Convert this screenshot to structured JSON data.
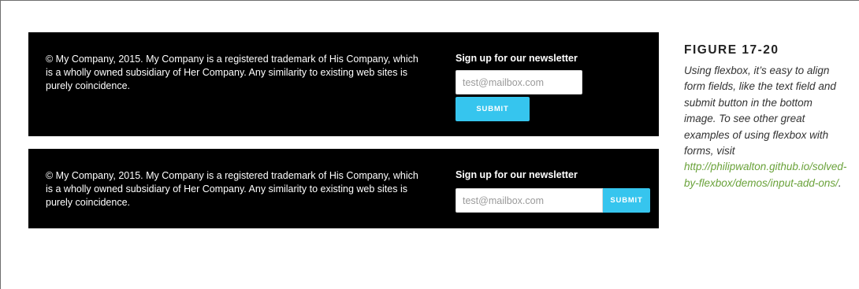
{
  "examples": {
    "top": {
      "copyright": "© My Company, 2015. My Company is a registered trademark of His Company, which is a wholly owned subsidiary of Her Company. Any similarity to existing web sites is purely coincidence.",
      "newsletter_title": "Sign up for our newsletter",
      "email_placeholder": "test@mailbox.com",
      "submit_label": "SUBMIT"
    },
    "bottom": {
      "copyright": "© My Company, 2015. My Company is a registered trademark of His Company, which is a wholly owned subsidiary of Her Company. Any similarity to existing web sites is purely coincidence.",
      "newsletter_title": "Sign up for our newsletter",
      "email_placeholder": "test@mailbox.com",
      "submit_label": "SUBMIT"
    }
  },
  "caption": {
    "figure_label": "FIGURE 17-20",
    "text": "Using flexbox, it’s easy to align form fields, like the text field and submit button in the bottom image. To see other great examples of using flexbox with forms, visit ",
    "link_text": "http://philipwalton.github.io/solved-by-flexbox/demos/input-add-ons/",
    "text_end": "."
  },
  "colors": {
    "footer_background": "#000000",
    "submit_button": "#36c5ee",
    "link": "#6aa23a"
  }
}
